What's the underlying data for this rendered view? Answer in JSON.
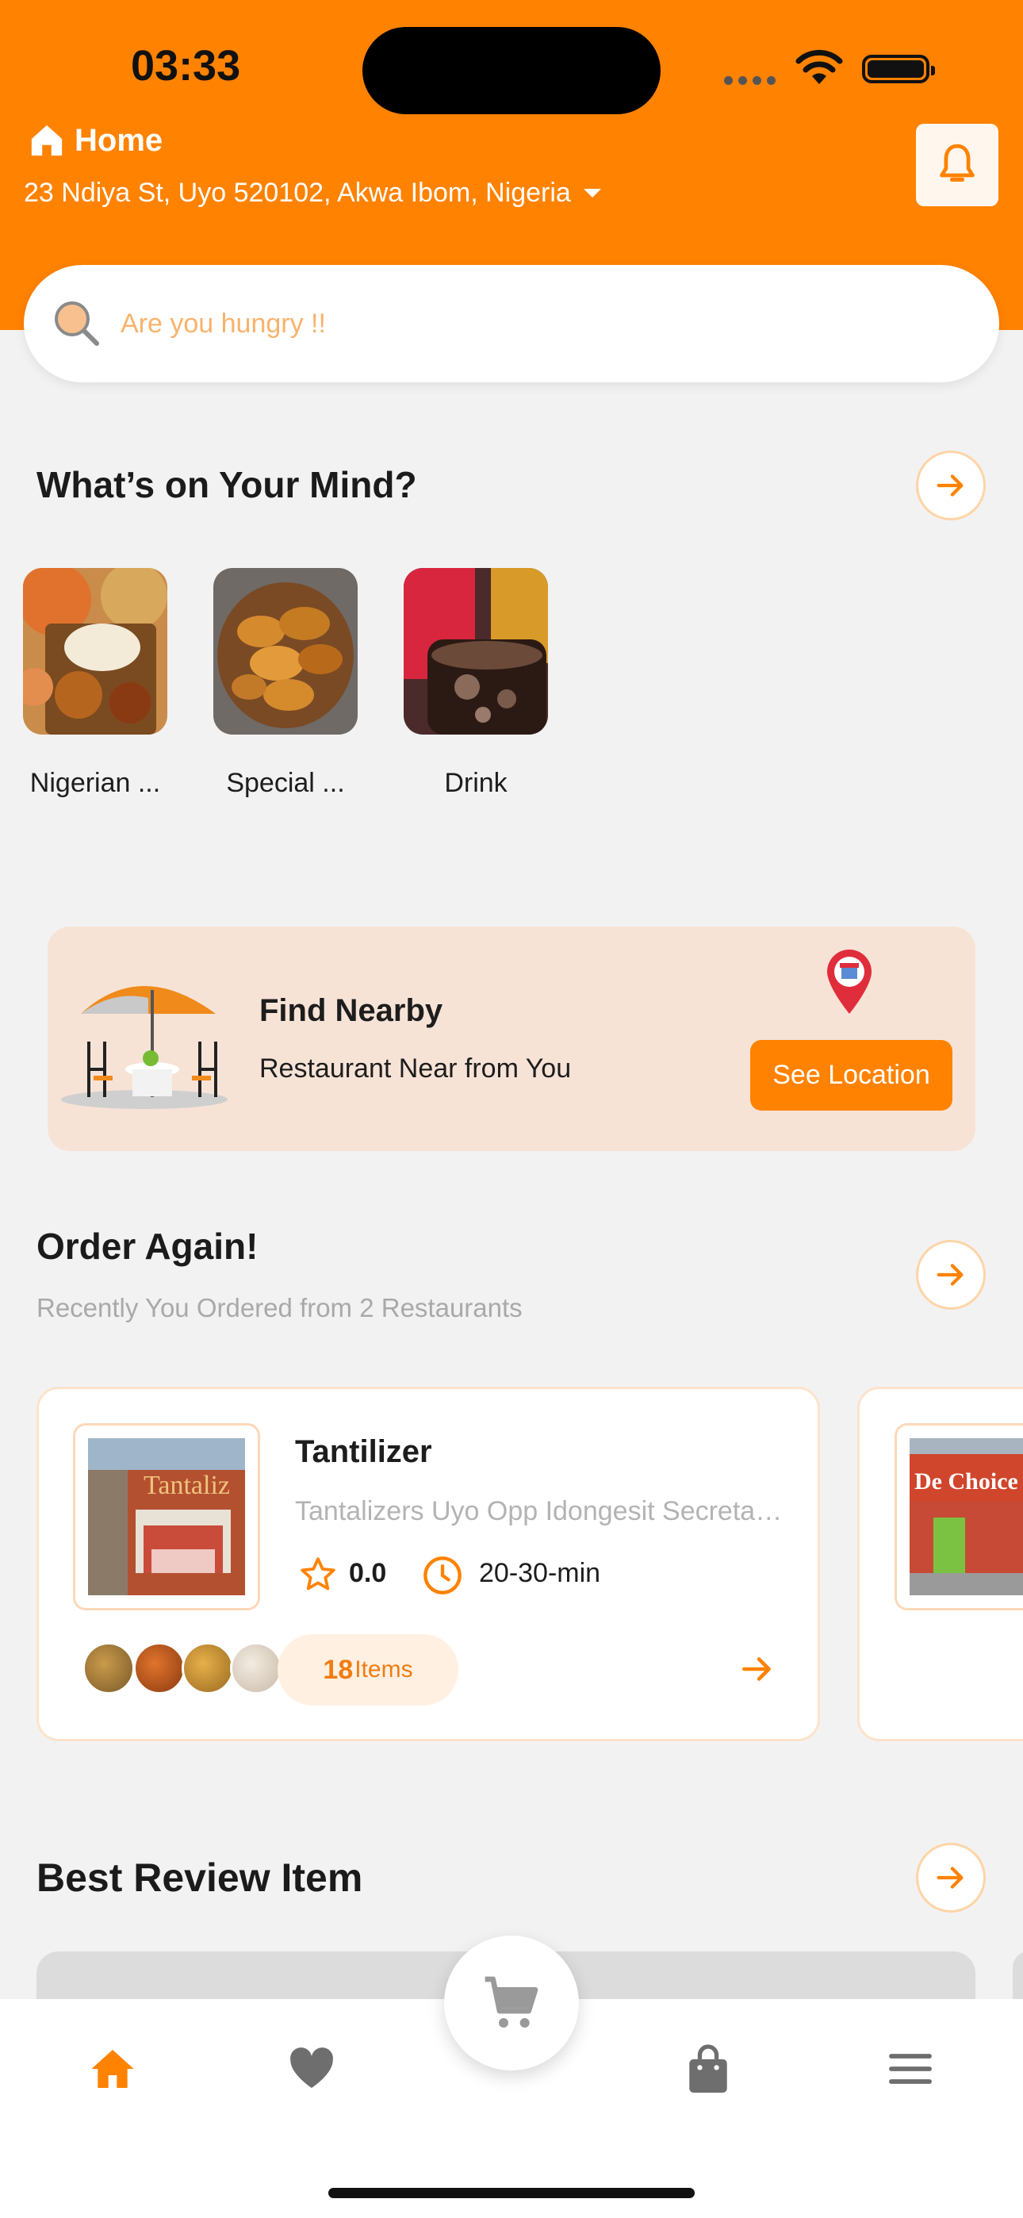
{
  "status_bar": {
    "time": "03:33"
  },
  "header": {
    "location_label": "Home",
    "address": "23 Ndiya St, Uyo 520102, Akwa Ibom, Nigeria"
  },
  "search": {
    "placeholder": "Are you hungry !!"
  },
  "mind_section": {
    "title": "What’s on Your Mind?",
    "categories": [
      {
        "label": "Nigerian ..."
      },
      {
        "label": "Special ..."
      },
      {
        "label": "Drink"
      }
    ]
  },
  "nearby": {
    "title": "Find Nearby",
    "subtitle": "Restaurant Near from You",
    "button": "See Location"
  },
  "order_again": {
    "title": "Order Again!",
    "subtitle": "Recently You Ordered from 2 Restaurants",
    "restaurants": [
      {
        "name": "Tantilizer",
        "address": "Tantalizers Uyo Opp Idongesit Secretariat",
        "image_text": "Tantaliz",
        "rating": "0.0",
        "eta": "20-30-min",
        "items_count": "18",
        "items_label": "Items"
      },
      {
        "image_text": "De Choice"
      }
    ]
  },
  "best_review": {
    "title": "Best Review Item"
  },
  "tab_bar": {
    "items": [
      "home-icon",
      "heart-icon",
      "cart-icon",
      "bag-icon",
      "menu-icon"
    ],
    "active_color": "#FF8200",
    "inactive_color": "#6E6E6E"
  }
}
